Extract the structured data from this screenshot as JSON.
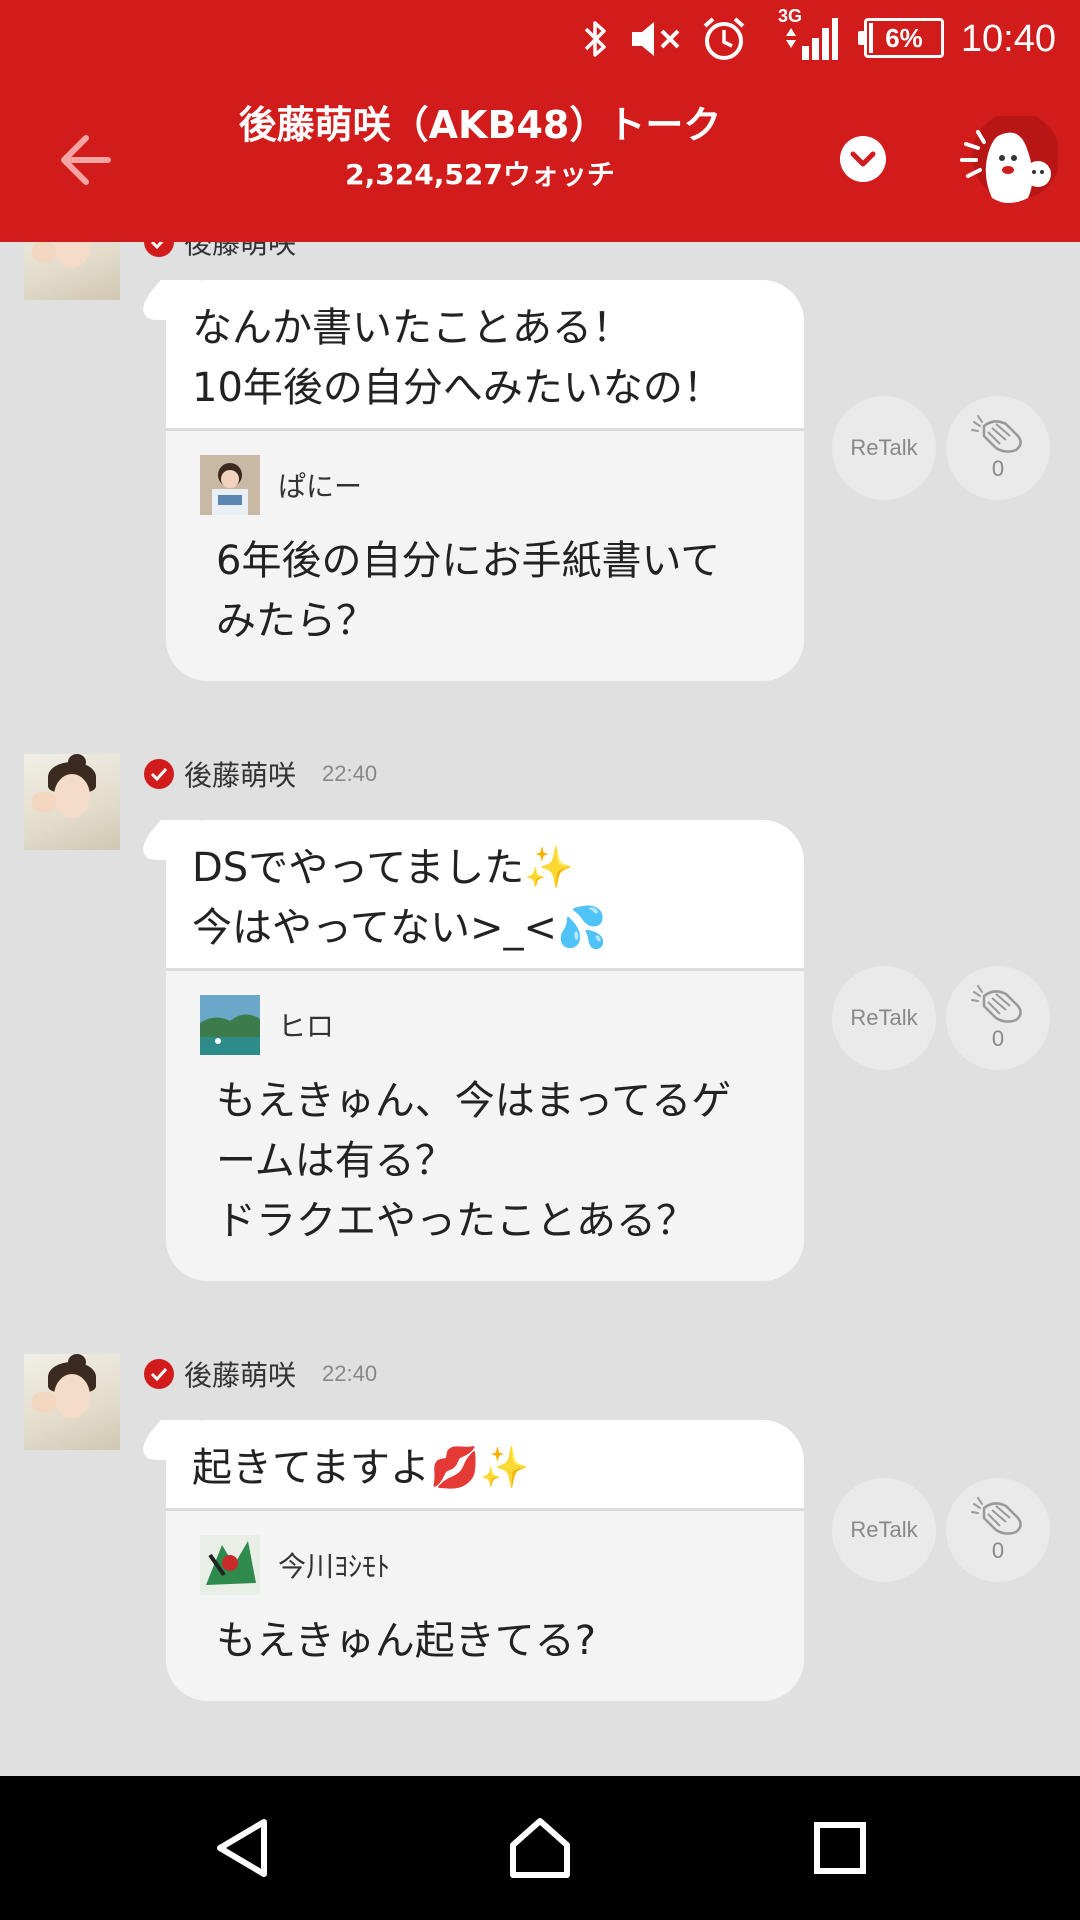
{
  "status_bar": {
    "time": "10:40",
    "battery_text": "6%",
    "battery_level": 0.06,
    "network_label": "3G",
    "icons": [
      "bluetooth-icon",
      "volume-muted-icon",
      "alarm-icon",
      "signal-icon",
      "battery-icon"
    ]
  },
  "app_bar": {
    "title": "後藤萌咲（AKB48）トーク",
    "watch_count": "2,324,527ウォッチ",
    "back_icon": "arrow-left-icon",
    "dropdown_icon": "chevron-down-icon",
    "mascot_icon": "mascot-icon"
  },
  "messages": [
    {
      "author": "後藤萌咲",
      "time": "",
      "text": "なんか書いたことある！\n10年後の自分へみたいなの！",
      "quote": {
        "author": "ぱにー",
        "text": "6年後の自分にお手紙書いて\nみたら？"
      },
      "retalk_label": "ReTalk",
      "clap_count": "0"
    },
    {
      "author": "後藤萌咲",
      "time": "22:40",
      "text": "DSでやってました✨\n今はやってない>_<💦",
      "quote": {
        "author": "ヒロ",
        "text": "もえきゅん、今はまってるゲ\nームは有る？\nドラクエやったことある？"
      },
      "retalk_label": "ReTalk",
      "clap_count": "0"
    },
    {
      "author": "後藤萌咲",
      "time": "22:40",
      "text": "起きてますよ💋✨",
      "quote": {
        "author": "今川ﾖｼﾓﾄ",
        "text": "もえきゅん起きてる?"
      },
      "retalk_label": "ReTalk",
      "clap_count": "0"
    }
  ],
  "nav_bar": {
    "icons": [
      "back-triangle-icon",
      "home-icon",
      "recents-icon"
    ]
  },
  "colors": {
    "brand_red": "#d21c1c",
    "chat_background": "#e0e0e0",
    "bubble": "#ffffff",
    "quote_background": "#f4f4f4"
  }
}
